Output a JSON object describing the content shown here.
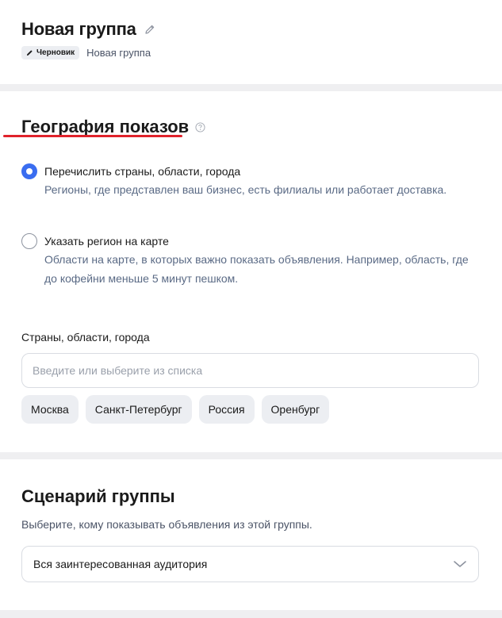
{
  "group": {
    "title": "Новая группа",
    "status_badge": "Черновик",
    "status_name": "Новая группа"
  },
  "geography": {
    "title": "География показов",
    "options": [
      {
        "label": "Перечислить страны, области, города",
        "description": "Регионы, где представлен ваш бизнес, есть филиалы или работает доставка.",
        "selected": true
      },
      {
        "label": "Указать регион на карте",
        "description": "Области на карте, в которых важно показать объявления. Например, область, где до кофейни меньше 5 минут пешком.",
        "selected": false
      }
    ],
    "field_label": "Страны, области, города",
    "input_placeholder": "Введите или выберите из списка",
    "input_value": "",
    "suggestions": [
      "Москва",
      "Санкт-Петербург",
      "Россия",
      "Оренбург"
    ]
  },
  "scenario": {
    "title": "Сценарий группы",
    "description": "Выберите, кому показывать объявления из этой группы.",
    "selected_value": "Вся заинтересованная аудитория"
  },
  "colors": {
    "accent": "#3a6df0",
    "annotation_underline": "#e0222b",
    "page_background": "#efeff1",
    "chip_background": "#eceef2"
  },
  "icons": {
    "title_edit": "pencil-icon",
    "badge": "pencil-icon",
    "help": "question-circle-icon",
    "select": "chevron-down-icon"
  }
}
